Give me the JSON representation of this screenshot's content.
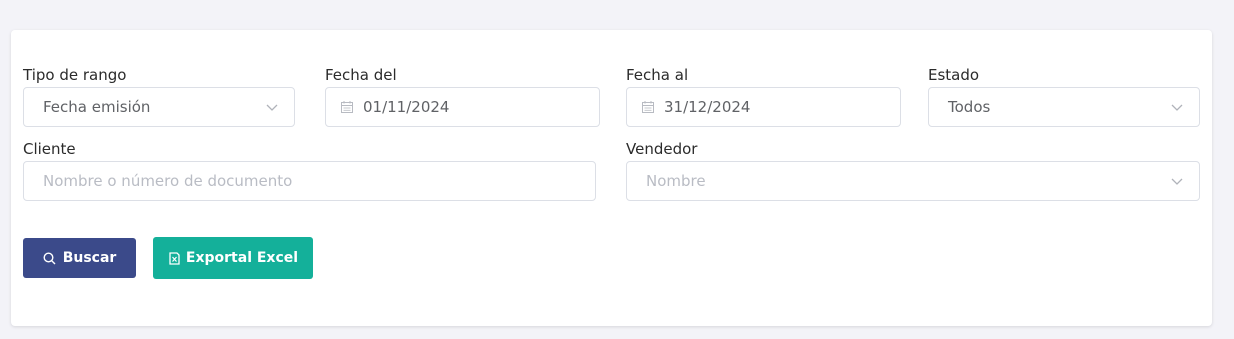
{
  "filters": {
    "range_type": {
      "label": "Tipo de rango",
      "value": "Fecha emisión"
    },
    "date_from": {
      "label": "Fecha del",
      "value": "01/11/2024"
    },
    "date_to": {
      "label": "Fecha al",
      "value": "31/12/2024"
    },
    "status": {
      "label": "Estado",
      "value": "Todos"
    },
    "client": {
      "label": "Cliente",
      "placeholder": "Nombre o número de documento"
    },
    "seller": {
      "label": "Vendedor",
      "placeholder": "Nombre"
    }
  },
  "actions": {
    "search_label": "Buscar",
    "export_label": "Exportal Excel"
  },
  "icons": {
    "search": "search-icon",
    "export": "excel-file-icon",
    "calendar": "calendar-icon",
    "dropdown": "chevron-down-icon"
  },
  "colors": {
    "search_button": "#3b4a8a",
    "export_button": "#14b09a",
    "page_background": "#f3f3f8"
  }
}
